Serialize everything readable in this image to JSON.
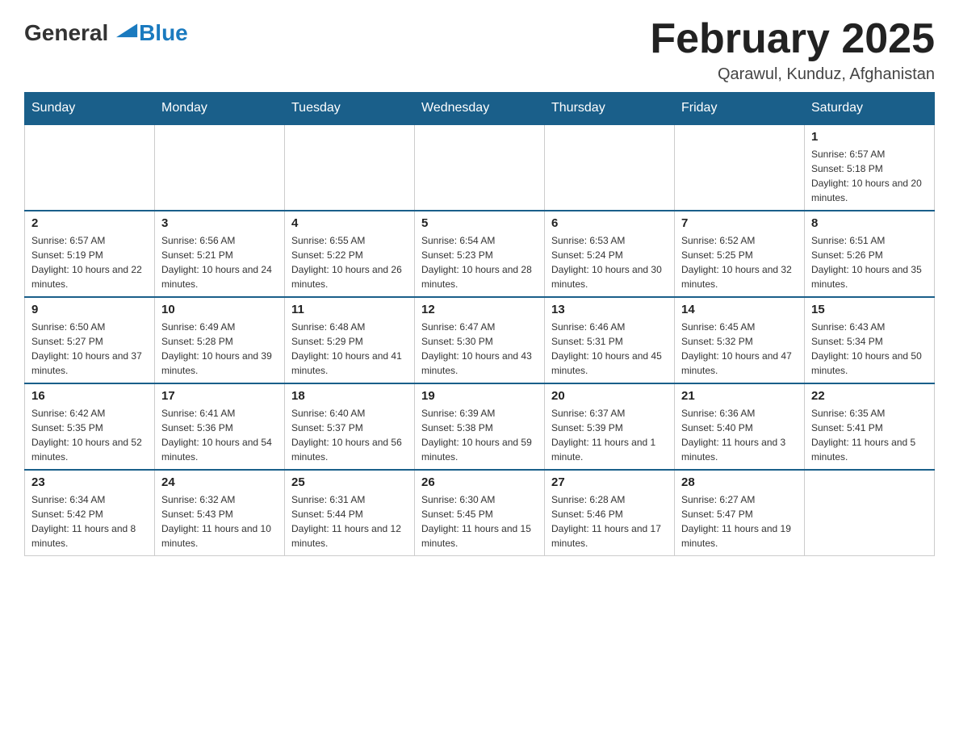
{
  "header": {
    "logo_general": "General",
    "logo_blue": "Blue",
    "month_title": "February 2025",
    "location": "Qarawul, Kunduz, Afghanistan"
  },
  "weekdays": [
    "Sunday",
    "Monday",
    "Tuesday",
    "Wednesday",
    "Thursday",
    "Friday",
    "Saturday"
  ],
  "weeks": [
    [
      {
        "day": "",
        "sunrise": "",
        "sunset": "",
        "daylight": ""
      },
      {
        "day": "",
        "sunrise": "",
        "sunset": "",
        "daylight": ""
      },
      {
        "day": "",
        "sunrise": "",
        "sunset": "",
        "daylight": ""
      },
      {
        "day": "",
        "sunrise": "",
        "sunset": "",
        "daylight": ""
      },
      {
        "day": "",
        "sunrise": "",
        "sunset": "",
        "daylight": ""
      },
      {
        "day": "",
        "sunrise": "",
        "sunset": "",
        "daylight": ""
      },
      {
        "day": "1",
        "sunrise": "Sunrise: 6:57 AM",
        "sunset": "Sunset: 5:18 PM",
        "daylight": "Daylight: 10 hours and 20 minutes."
      }
    ],
    [
      {
        "day": "2",
        "sunrise": "Sunrise: 6:57 AM",
        "sunset": "Sunset: 5:19 PM",
        "daylight": "Daylight: 10 hours and 22 minutes."
      },
      {
        "day": "3",
        "sunrise": "Sunrise: 6:56 AM",
        "sunset": "Sunset: 5:21 PM",
        "daylight": "Daylight: 10 hours and 24 minutes."
      },
      {
        "day": "4",
        "sunrise": "Sunrise: 6:55 AM",
        "sunset": "Sunset: 5:22 PM",
        "daylight": "Daylight: 10 hours and 26 minutes."
      },
      {
        "day": "5",
        "sunrise": "Sunrise: 6:54 AM",
        "sunset": "Sunset: 5:23 PM",
        "daylight": "Daylight: 10 hours and 28 minutes."
      },
      {
        "day": "6",
        "sunrise": "Sunrise: 6:53 AM",
        "sunset": "Sunset: 5:24 PM",
        "daylight": "Daylight: 10 hours and 30 minutes."
      },
      {
        "day": "7",
        "sunrise": "Sunrise: 6:52 AM",
        "sunset": "Sunset: 5:25 PM",
        "daylight": "Daylight: 10 hours and 32 minutes."
      },
      {
        "day": "8",
        "sunrise": "Sunrise: 6:51 AM",
        "sunset": "Sunset: 5:26 PM",
        "daylight": "Daylight: 10 hours and 35 minutes."
      }
    ],
    [
      {
        "day": "9",
        "sunrise": "Sunrise: 6:50 AM",
        "sunset": "Sunset: 5:27 PM",
        "daylight": "Daylight: 10 hours and 37 minutes."
      },
      {
        "day": "10",
        "sunrise": "Sunrise: 6:49 AM",
        "sunset": "Sunset: 5:28 PM",
        "daylight": "Daylight: 10 hours and 39 minutes."
      },
      {
        "day": "11",
        "sunrise": "Sunrise: 6:48 AM",
        "sunset": "Sunset: 5:29 PM",
        "daylight": "Daylight: 10 hours and 41 minutes."
      },
      {
        "day": "12",
        "sunrise": "Sunrise: 6:47 AM",
        "sunset": "Sunset: 5:30 PM",
        "daylight": "Daylight: 10 hours and 43 minutes."
      },
      {
        "day": "13",
        "sunrise": "Sunrise: 6:46 AM",
        "sunset": "Sunset: 5:31 PM",
        "daylight": "Daylight: 10 hours and 45 minutes."
      },
      {
        "day": "14",
        "sunrise": "Sunrise: 6:45 AM",
        "sunset": "Sunset: 5:32 PM",
        "daylight": "Daylight: 10 hours and 47 minutes."
      },
      {
        "day": "15",
        "sunrise": "Sunrise: 6:43 AM",
        "sunset": "Sunset: 5:34 PM",
        "daylight": "Daylight: 10 hours and 50 minutes."
      }
    ],
    [
      {
        "day": "16",
        "sunrise": "Sunrise: 6:42 AM",
        "sunset": "Sunset: 5:35 PM",
        "daylight": "Daylight: 10 hours and 52 minutes."
      },
      {
        "day": "17",
        "sunrise": "Sunrise: 6:41 AM",
        "sunset": "Sunset: 5:36 PM",
        "daylight": "Daylight: 10 hours and 54 minutes."
      },
      {
        "day": "18",
        "sunrise": "Sunrise: 6:40 AM",
        "sunset": "Sunset: 5:37 PM",
        "daylight": "Daylight: 10 hours and 56 minutes."
      },
      {
        "day": "19",
        "sunrise": "Sunrise: 6:39 AM",
        "sunset": "Sunset: 5:38 PM",
        "daylight": "Daylight: 10 hours and 59 minutes."
      },
      {
        "day": "20",
        "sunrise": "Sunrise: 6:37 AM",
        "sunset": "Sunset: 5:39 PM",
        "daylight": "Daylight: 11 hours and 1 minute."
      },
      {
        "day": "21",
        "sunrise": "Sunrise: 6:36 AM",
        "sunset": "Sunset: 5:40 PM",
        "daylight": "Daylight: 11 hours and 3 minutes."
      },
      {
        "day": "22",
        "sunrise": "Sunrise: 6:35 AM",
        "sunset": "Sunset: 5:41 PM",
        "daylight": "Daylight: 11 hours and 5 minutes."
      }
    ],
    [
      {
        "day": "23",
        "sunrise": "Sunrise: 6:34 AM",
        "sunset": "Sunset: 5:42 PM",
        "daylight": "Daylight: 11 hours and 8 minutes."
      },
      {
        "day": "24",
        "sunrise": "Sunrise: 6:32 AM",
        "sunset": "Sunset: 5:43 PM",
        "daylight": "Daylight: 11 hours and 10 minutes."
      },
      {
        "day": "25",
        "sunrise": "Sunrise: 6:31 AM",
        "sunset": "Sunset: 5:44 PM",
        "daylight": "Daylight: 11 hours and 12 minutes."
      },
      {
        "day": "26",
        "sunrise": "Sunrise: 6:30 AM",
        "sunset": "Sunset: 5:45 PM",
        "daylight": "Daylight: 11 hours and 15 minutes."
      },
      {
        "day": "27",
        "sunrise": "Sunrise: 6:28 AM",
        "sunset": "Sunset: 5:46 PM",
        "daylight": "Daylight: 11 hours and 17 minutes."
      },
      {
        "day": "28",
        "sunrise": "Sunrise: 6:27 AM",
        "sunset": "Sunset: 5:47 PM",
        "daylight": "Daylight: 11 hours and 19 minutes."
      },
      {
        "day": "",
        "sunrise": "",
        "sunset": "",
        "daylight": ""
      }
    ]
  ]
}
